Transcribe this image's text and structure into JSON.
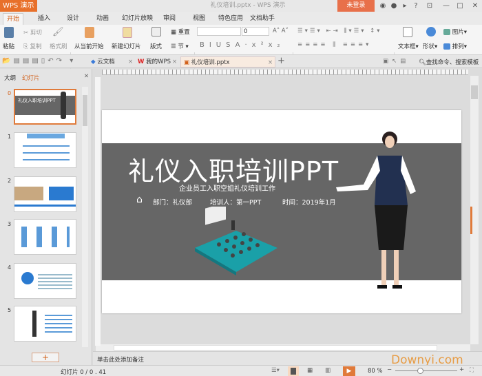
{
  "app": {
    "name": "WPS 演示",
    "window_title": "礼仪培训.pptx - WPS 演示",
    "login": "未登录"
  },
  "menu_tabs": [
    "开始",
    "插入",
    "设计",
    "动画",
    "幻灯片放映",
    "审阅",
    "视图",
    "特色应用",
    "文档助手"
  ],
  "ribbon": {
    "paste": "粘贴",
    "cut": "剪切",
    "copy": "复制",
    "format_painter": "格式刷",
    "from_current": "从当前开始",
    "new_slide": "新建幻灯片",
    "layout": "版式",
    "reset": "重置",
    "section": "节",
    "font_size": "0",
    "text_box": "文本框",
    "shape": "形状",
    "picture": "图片",
    "arrange": "排列"
  },
  "doc_tabs": [
    {
      "label": "云文档"
    },
    {
      "label": "我的WPS"
    },
    {
      "label": "礼仪培训.pptx"
    }
  ],
  "search": "查找命令、搜索模板",
  "panel": {
    "tab_outline": "大纲",
    "tab_slides": "幻灯片",
    "slide_numbers": [
      "0",
      "1",
      "2",
      "3",
      "4",
      "5"
    ],
    "add_button": "+"
  },
  "slide": {
    "title": "礼仪入职培训PPT",
    "subtitle": "企业员工入职空姐礼仪培训工作",
    "department": "部门：礼仪部",
    "trainer": "培训人：第一PPT",
    "date": "时间：2019年1月"
  },
  "notes_placeholder": "单击此处添加备注",
  "status": {
    "slide_counter": "幻灯片 0 / 0 . 41",
    "zoom": "80 %"
  },
  "watermark": "Downyi.com",
  "colors": {
    "accent": "#e8702a",
    "band": "#666666"
  }
}
